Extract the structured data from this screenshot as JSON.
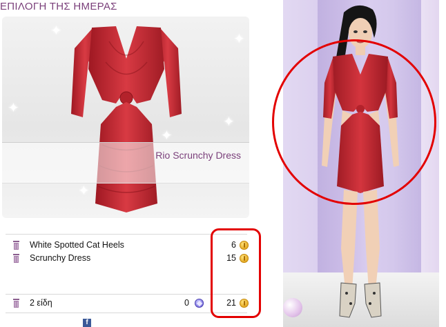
{
  "section_title": "ΕΠΙΛΟΓΗ ΤΗΣ ΗΜΕΡΑΣ",
  "featured_item": {
    "name": "Rio Scrunchy Dress",
    "color": "#c8262f"
  },
  "cart": {
    "items": [
      {
        "name": "White Spotted Cat Heels",
        "price": "6",
        "currency_icon": "coin-icon"
      },
      {
        "name": "Scrunchy Dress",
        "price": "15",
        "currency_icon": "coin-icon"
      }
    ],
    "summary": {
      "count_label": "2 είδη",
      "gems_total": "0",
      "coins_total": "21"
    }
  },
  "colors": {
    "accent_purple": "#7a3f7a",
    "highlight_red": "#e30000",
    "coin_gold": "#e3a51b",
    "gem_purple": "#7a6fe0"
  }
}
